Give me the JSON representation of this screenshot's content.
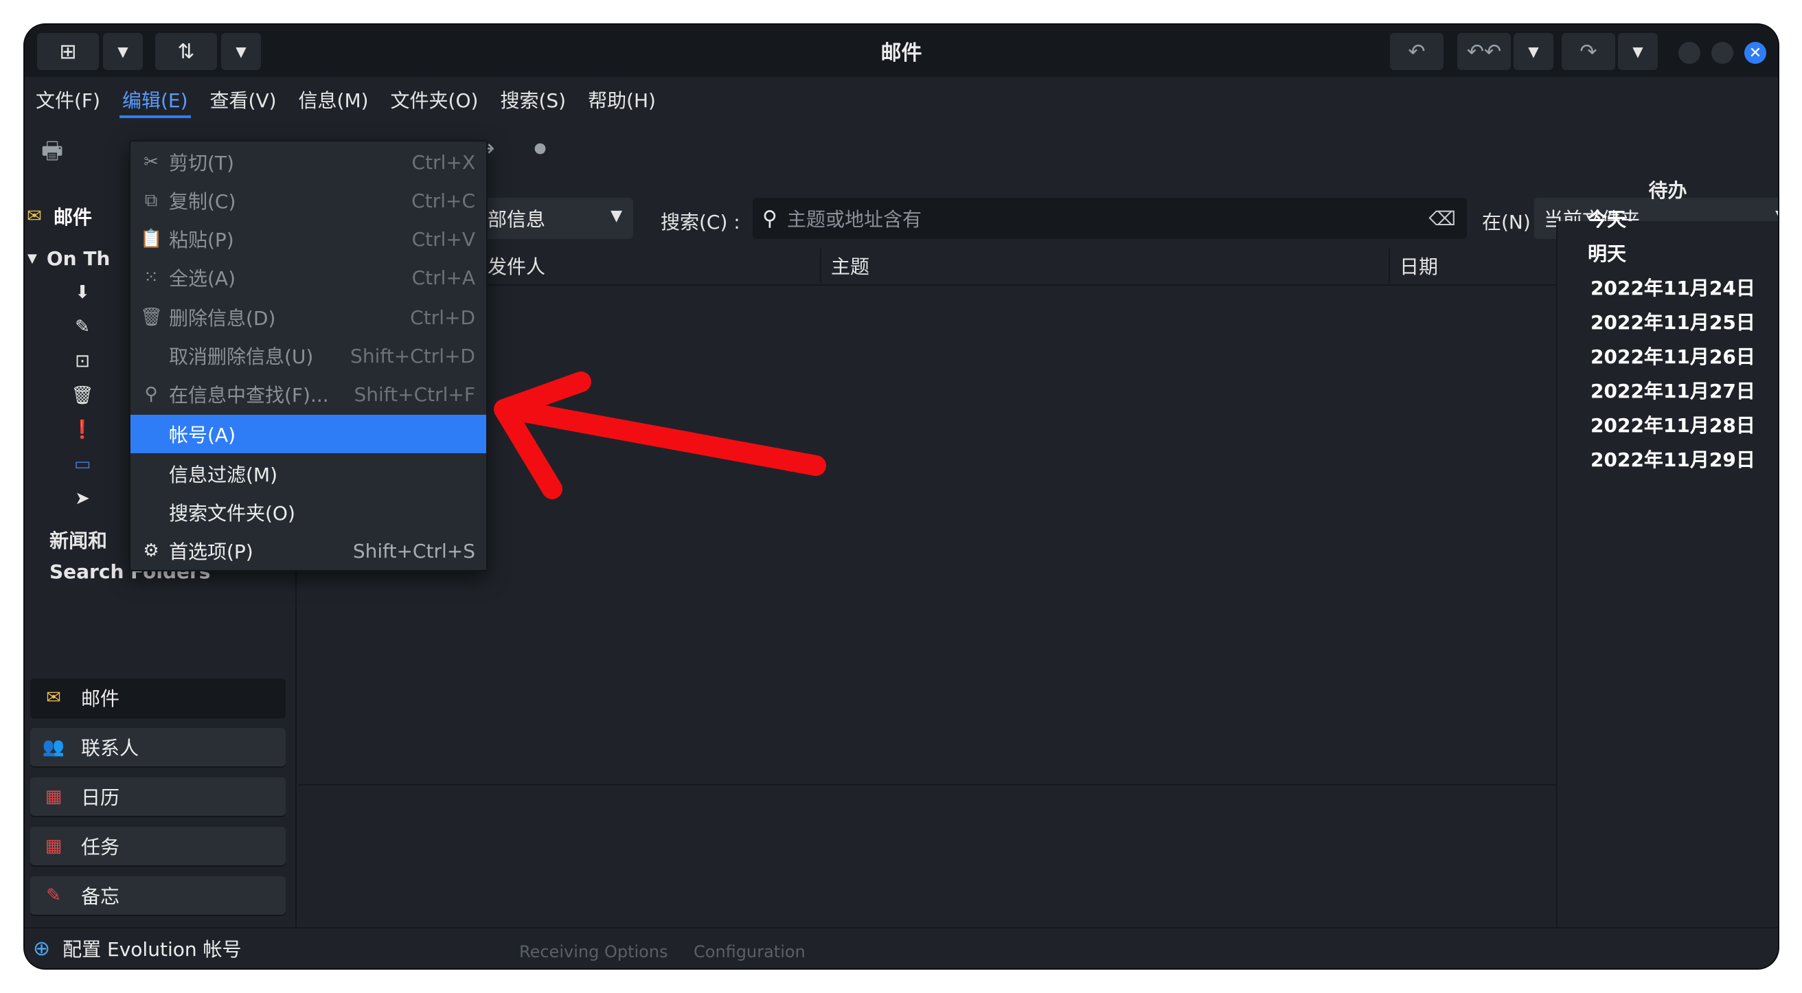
{
  "window": {
    "title": "邮件"
  },
  "menubar": {
    "items": [
      "文件(F)",
      "编辑(E)",
      "查看(V)",
      "信息(M)",
      "文件夹(O)",
      "搜索(S)",
      "帮助(H)"
    ]
  },
  "sidebar": {
    "account_header": "邮件",
    "tree": {
      "root": "On Th",
      "news": "新闻和",
      "search_folders": "Search Folders"
    },
    "nav": [
      "邮件",
      "联系人",
      "日历",
      "任务",
      "备忘"
    ]
  },
  "main": {
    "show_combo": "部信息",
    "search_label": "搜索(C) :",
    "search_placeholder": "主题或地址含有",
    "in_label": "在(N)",
    "scope_combo": "当前文件夹",
    "columns": [
      "发件人",
      "主题",
      "日期"
    ]
  },
  "todo": {
    "title": "待办",
    "items": [
      "今天",
      "明天",
      "2022年11月24日",
      "2022年11月25日",
      "2022年11月26日",
      "2022年11月27日",
      "2022年11月28日",
      "2022年11月29日"
    ]
  },
  "edit_menu": {
    "items": [
      {
        "label": "剪切(T)",
        "accel": "Ctrl+X"
      },
      {
        "label": "复制(C)",
        "accel": "Ctrl+C"
      },
      {
        "label": "粘贴(P)",
        "accel": "Ctrl+V"
      },
      {
        "label": "全选(A)",
        "accel": "Ctrl+A"
      },
      {
        "label": "删除信息(D)",
        "accel": "Ctrl+D"
      },
      {
        "label": "取消删除信息(U)",
        "accel": "Shift+Ctrl+D"
      },
      {
        "label": "在信息中查找(F)...",
        "accel": "Shift+Ctrl+F"
      },
      {
        "label": "帐号(A)",
        "accel": ""
      },
      {
        "label": "信息过滤(M)",
        "accel": ""
      },
      {
        "label": "搜索文件夹(O)",
        "accel": ""
      },
      {
        "label": "首选项(P)",
        "accel": "Shift+Ctrl+S"
      }
    ]
  },
  "statusbar": {
    "text": "配置 Evolution 帐号",
    "ghost": [
      "Receiving Options",
      "Configuration"
    ]
  },
  "colors": {
    "accent": "#2f7df6",
    "annotation_arrow": "#f20d12"
  }
}
